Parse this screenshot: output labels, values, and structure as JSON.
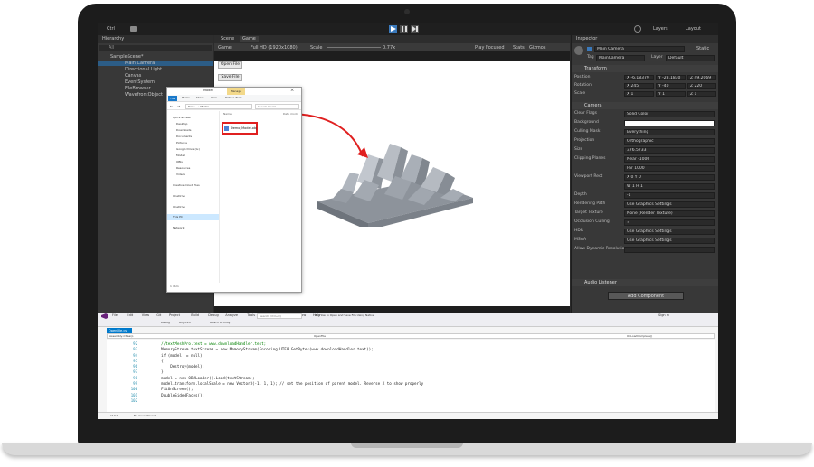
{
  "unity": {
    "toolbar": {
      "layers": "Layers",
      "layout": "Layout",
      "play_icon": "play-icon",
      "pause_icon": "pause-icon",
      "step_icon": "step-icon",
      "collab": "Ctrl"
    },
    "hierarchy": {
      "tab": "Hierarchy",
      "search": "All",
      "scene": "SampleScene*",
      "items": [
        "Main Camera",
        "Directional Light",
        "Canvas",
        "EventSystem",
        "FileBrowser",
        "WavefrontObject"
      ]
    },
    "tabs": {
      "scene": "Scene",
      "game": "Game"
    },
    "game_bar": {
      "display": "Game",
      "resolution": "Full HD (1920x1080)",
      "scale_label": "Scale",
      "scale_value": "0.77x",
      "play_mode": "Play Focused",
      "stats": "Stats",
      "gizmos": "Gizmos"
    },
    "buttons": {
      "open": "Open File",
      "save": "Save File"
    },
    "inspector": {
      "tab": "Inspector",
      "object": "Main Camera",
      "static": "Static",
      "tag_label": "Tag",
      "tag": "MainCamera",
      "layer_label": "Layer",
      "layer": "Default",
      "transform": {
        "title": "Transform",
        "position_label": "Position",
        "rotation_label": "Rotation",
        "scale_label": "Scale",
        "position": [
          "X -6.18379",
          "Y -28.1830",
          "Z 49.2069"
        ],
        "rotation": [
          "X 245",
          "Y -40",
          "Z 220"
        ],
        "scale": [
          "X 1",
          "Y 1",
          "Z 1"
        ]
      },
      "camera": {
        "title": "Camera",
        "rows": [
          {
            "label": "Clear Flags",
            "value": "Solid Color"
          },
          {
            "label": "Background",
            "value": ""
          },
          {
            "label": "Culling Mask",
            "value": "Everything"
          },
          {
            "label": "Projection",
            "value": "Orthographic"
          },
          {
            "label": "Size",
            "value": "376.5733"
          },
          {
            "label": "Clipping Planes",
            "value": "Near  -1000"
          },
          {
            "label": "",
            "value": "Far   1000"
          },
          {
            "label": "Viewport Rect",
            "value": "X 0    Y 0"
          },
          {
            "label": "",
            "value": "W 1    H 1"
          },
          {
            "label": "Depth",
            "value": "-1"
          },
          {
            "label": "Rendering Path",
            "value": "Use Graphics Settings"
          },
          {
            "label": "Target Texture",
            "value": "None (Render Texture)"
          },
          {
            "label": "Occlusion Culling",
            "value": "✓"
          },
          {
            "label": "HDR",
            "value": "Use Graphics Settings"
          },
          {
            "label": "MSAA",
            "value": "Use Graphics Settings"
          },
          {
            "label": "Allow Dynamic Resolution",
            "value": ""
          }
        ]
      },
      "audio": "Audio Listener",
      "add_component": "Add Component"
    }
  },
  "explorer": {
    "title": "Model",
    "ribbon_tab": "Manage",
    "ribbon": [
      "File",
      "Home",
      "Share",
      "View",
      "Picture Tools"
    ],
    "address": "Desk... › Model",
    "search": "Search Model",
    "column": "Name",
    "column2": "Date modi",
    "nav": [
      "Quick access",
      "Desktop",
      "Downloads",
      "Documents",
      "Pictures",
      "Google Drive (G:)",
      "Model",
      "OBJs",
      "Resources",
      "Videos",
      "Creative Cloud Files",
      "OneDrive",
      "OneDrive",
      "This PC",
      "Network"
    ],
    "file": "Demo_Model.obj",
    "status": "1 item"
  },
  "vs": {
    "menu": [
      "File",
      "Edit",
      "View",
      "Git",
      "Project",
      "Build",
      "Debug",
      "Analyze",
      "Tools",
      "Extensions",
      "Window",
      "Help"
    ],
    "search": "Search (Ctrl+Q)",
    "title": "05_How to Open and Save File Using Native",
    "signin": "Sign in",
    "toolbar": [
      "Debug",
      "Any CPU",
      "Attach to Unity"
    ],
    "tab": "OpenFile.cs",
    "project": "Assembly-CSharp",
    "class": "OpenFile",
    "method": "OnLoadComplete()",
    "line_numbers": [
      "92",
      "93",
      "94",
      "95",
      "96",
      "97",
      "98",
      "99",
      "100",
      "101",
      "102"
    ],
    "code": [
      "        //textMeshPro.text = www.downloadHandler.text;",
      "        MemoryStream textStream = new MemoryStream(Encoding.UTF8.GetBytes(www.downloadHandler.text));",
      "        if (model != null)",
      "        {",
      "            Destroy(model);",
      "        }",
      "        model = new OBJLoader().Load(textStream);",
      "        model.transform.localScale = new Vector3(-1, 1, 1); // set the position of parent model. Reverse X to show properly",
      "        FitOnScreen();",
      "        DoubleSidedFaces();",
      ""
    ],
    "status_zoom": "110 %",
    "status_issues": "No issues found"
  },
  "colors": {
    "unity_bg": "#383838",
    "unity_dark": "#282828",
    "accent": "#3a79bb",
    "arrow": "#e02020",
    "model": "#9aa0a8",
    "vs_blue": "#007acc"
  }
}
